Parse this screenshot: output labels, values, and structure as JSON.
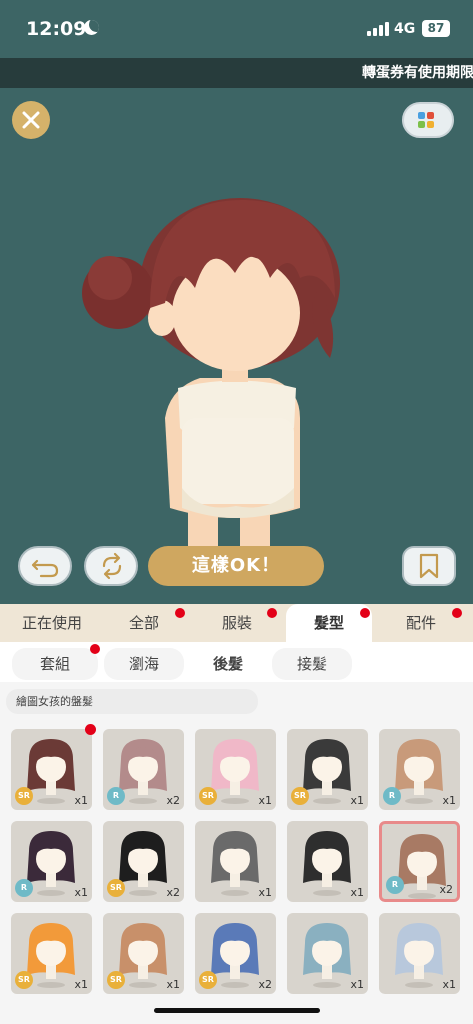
{
  "status": {
    "time": "12:09",
    "network": "4G",
    "battery": "87"
  },
  "marquee": {
    "text": "轉蛋券有使用期限"
  },
  "preview": {
    "ok_label": "這樣OK！"
  },
  "categories": [
    {
      "label": "正在使用",
      "dot": false,
      "active": false
    },
    {
      "label": "全部",
      "dot": true,
      "active": false
    },
    {
      "label": "服裝",
      "dot": true,
      "active": false
    },
    {
      "label": "髮型",
      "dot": true,
      "active": true
    },
    {
      "label": "配件",
      "dot": true,
      "active": false
    }
  ],
  "subcategories": [
    {
      "label": "套組",
      "dot": true
    },
    {
      "label": "瀏海",
      "dot": false
    },
    {
      "label": "後髮",
      "dot": false,
      "active": true
    },
    {
      "label": "接髮",
      "dot": false
    }
  ],
  "filter": {
    "label": "繪圖女孩的盤髮"
  },
  "items": [
    {
      "rarity": "SR",
      "qty": "x1",
      "hair": "#6b3a36",
      "new": true
    },
    {
      "rarity": "R",
      "qty": "x2",
      "hair": "#b38b8b",
      "new": false
    },
    {
      "rarity": "SR",
      "qty": "x1",
      "hair": "#f0b8c8",
      "new": false
    },
    {
      "rarity": "SR",
      "qty": "x1",
      "hair": "#3a3a3a",
      "new": false
    },
    {
      "rarity": "R",
      "qty": "x1",
      "hair": "#c89a7a",
      "new": false
    },
    {
      "rarity": "R",
      "qty": "x1",
      "hair": "#3b2a3a",
      "new": false
    },
    {
      "rarity": "SR",
      "qty": "x2",
      "hair": "#1e1e1e",
      "new": false
    },
    {
      "rarity": "",
      "qty": "x1",
      "hair": "#6a6a6a",
      "new": false
    },
    {
      "rarity": "",
      "qty": "x1",
      "hair": "#2e2e2e",
      "new": false
    },
    {
      "rarity": "R",
      "qty": "x2",
      "hair": "#a87a64",
      "new": false,
      "selected": true
    },
    {
      "rarity": "SR",
      "qty": "x1",
      "hair": "#f29a3a",
      "new": false
    },
    {
      "rarity": "SR",
      "qty": "x1",
      "hair": "#c8906a",
      "new": false
    },
    {
      "rarity": "SR",
      "qty": "x2",
      "hair": "#5a7ab8",
      "new": false
    },
    {
      "rarity": "",
      "qty": "x1",
      "hair": "#8ab0c0",
      "new": false
    },
    {
      "rarity": "",
      "qty": "x1",
      "hair": "#b8c8dc",
      "new": false
    }
  ],
  "colors": {
    "stage": "#3d6565",
    "gold": "#cfa760",
    "tab_bg": "#efe6d6",
    "badge_dot": "#e30018"
  }
}
